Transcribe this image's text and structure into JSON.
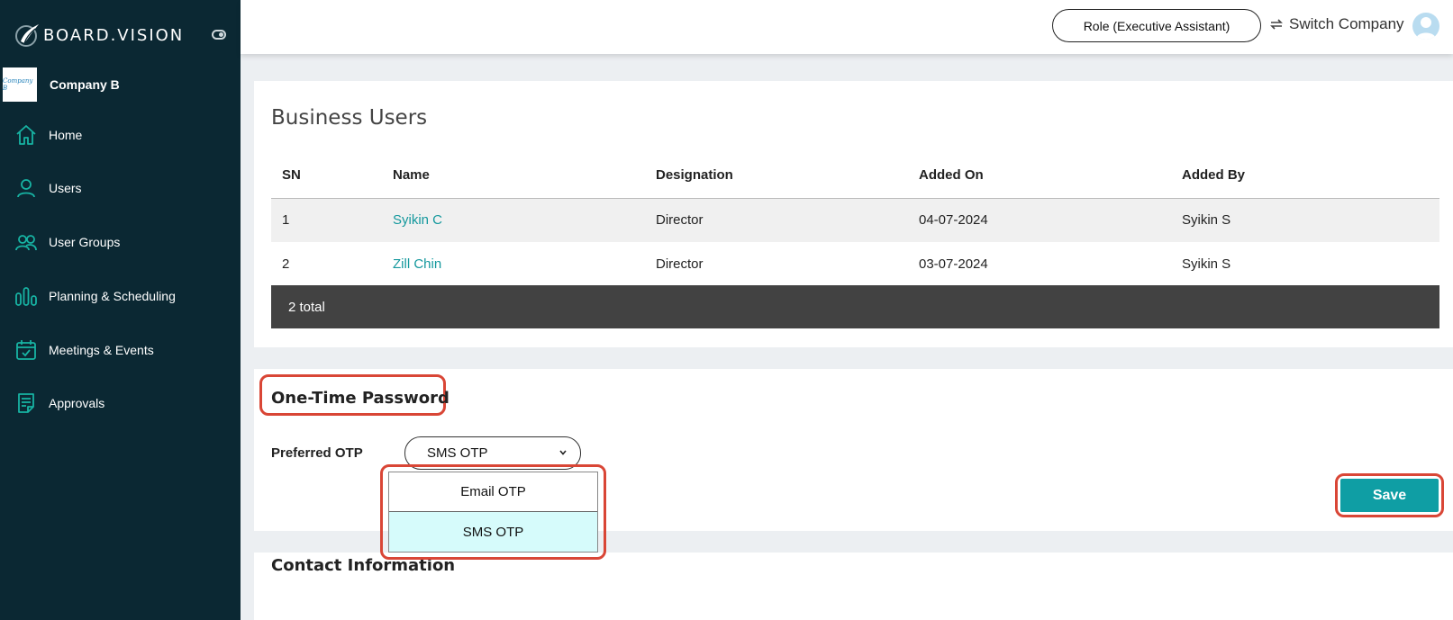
{
  "brand": {
    "name": "BOARD.VISION"
  },
  "company": {
    "logo_text": "Company B",
    "name": "Company B"
  },
  "sidebar": {
    "items": [
      {
        "label": "Home",
        "icon": "home-icon"
      },
      {
        "label": "Users",
        "icon": "user-icon"
      },
      {
        "label": "User Groups",
        "icon": "user-groups-icon"
      },
      {
        "label": "Planning & Scheduling",
        "icon": "planning-icon"
      },
      {
        "label": "Meetings & Events",
        "icon": "calendar-icon"
      },
      {
        "label": "Approvals",
        "icon": "approvals-icon"
      }
    ]
  },
  "topbar": {
    "role_label": "Role (Executive Assistant)",
    "switch_label": "Switch Company"
  },
  "business_users": {
    "title": "Business Users",
    "columns": [
      "SN",
      "Name",
      "Designation",
      "Added On",
      "Added By"
    ],
    "rows": [
      {
        "sn": "1",
        "name": "Syikin C",
        "designation": "Director",
        "added_on": "04-07-2024",
        "added_by": "Syikin S"
      },
      {
        "sn": "2",
        "name": "Zill Chin",
        "designation": "Director",
        "added_on": "03-07-2024",
        "added_by": "Syikin S"
      }
    ],
    "footer": "2 total"
  },
  "otp": {
    "title": "One-Time Password",
    "label": "Preferred OTP",
    "selected": "SMS OTP",
    "options": [
      "Email OTP",
      "SMS OTP"
    ],
    "save_label": "Save"
  },
  "contact": {
    "title": "Contact Information"
  },
  "colors": {
    "sidebar_bg": "#0b2833",
    "accent": "#0f9ea4",
    "link": "#14989d",
    "highlight": "#d94636",
    "selected_option": "#d6fbfb"
  }
}
